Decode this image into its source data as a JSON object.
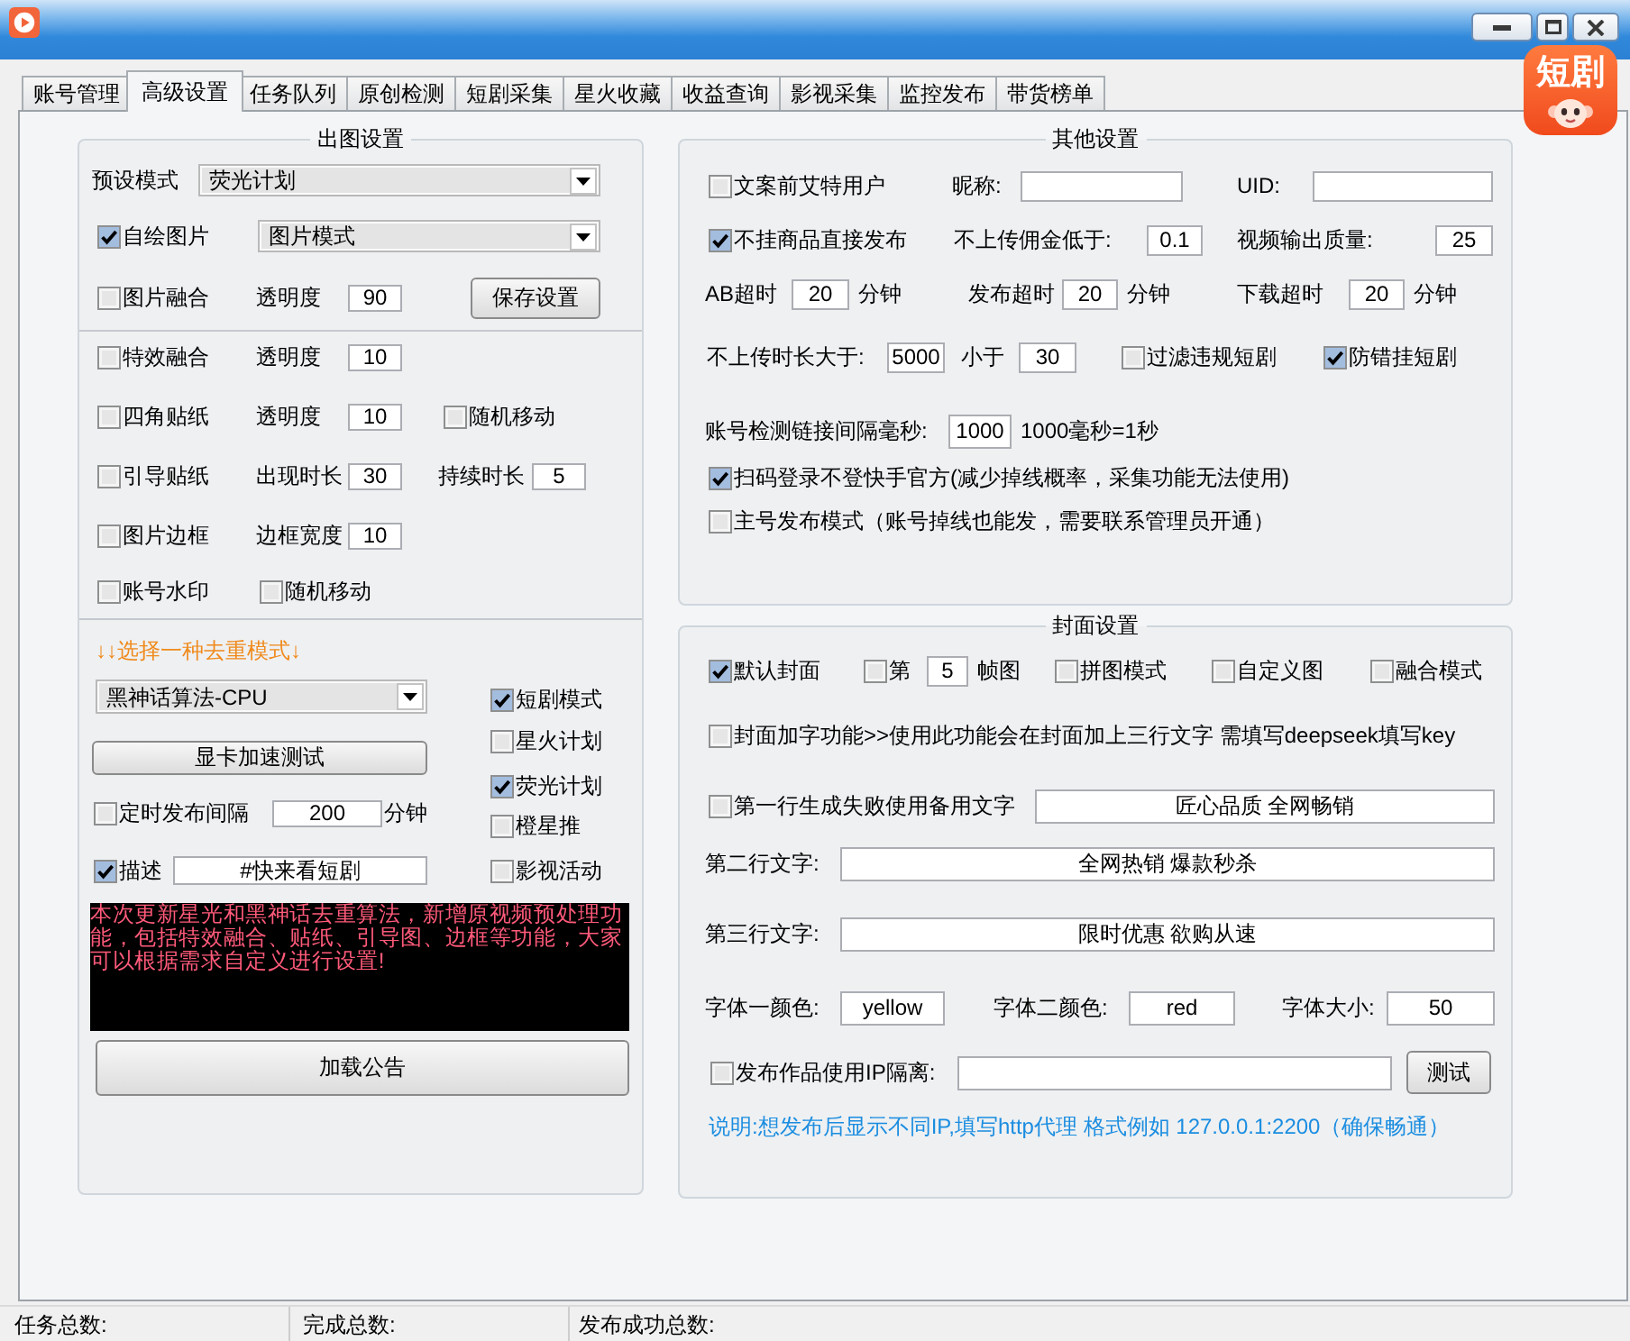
{
  "tabs": [
    {
      "label": "账号管理",
      "selected": false
    },
    {
      "label": "高级设置",
      "selected": true
    },
    {
      "label": "任务队列",
      "selected": false
    },
    {
      "label": "原创检测",
      "selected": false
    },
    {
      "label": "短剧采集",
      "selected": false
    },
    {
      "label": "星火收藏",
      "selected": false
    },
    {
      "label": "收益查询",
      "selected": false
    },
    {
      "label": "影视采集",
      "selected": false
    },
    {
      "label": "监控发布",
      "selected": false
    },
    {
      "label": "带货榜单",
      "selected": false
    }
  ],
  "logo": {
    "text": "短剧"
  },
  "output_settings": {
    "title": "出图设置",
    "rows": [
      {
        "controls": [
          {
            "kind": "label",
            "text": "预设模式"
          },
          {
            "kind": "select",
            "value": "荧光计划"
          }
        ]
      },
      {
        "controls": [
          {
            "kind": "checkbox",
            "label": "自绘图片",
            "checked": true
          },
          {
            "kind": "select",
            "value": "图片模式"
          }
        ]
      },
      {
        "controls": [
          {
            "kind": "checkbox",
            "label": "图片融合",
            "checked": false
          },
          {
            "kind": "label",
            "text": "透明度"
          },
          {
            "kind": "input",
            "value": "90"
          },
          {
            "kind": "button",
            "label": "保存设置"
          }
        ]
      }
    ],
    "effect_rows": [
      {
        "controls": [
          {
            "kind": "checkbox",
            "label": "特效融合",
            "checked": false
          },
          {
            "kind": "label",
            "text": "透明度"
          },
          {
            "kind": "input",
            "value": "10"
          }
        ]
      },
      {
        "controls": [
          {
            "kind": "checkbox",
            "label": "四角贴纸",
            "checked": false
          },
          {
            "kind": "label",
            "text": "透明度"
          },
          {
            "kind": "input",
            "value": "10"
          },
          {
            "kind": "checkbox",
            "label": "随机移动",
            "checked": false
          }
        ]
      },
      {
        "controls": [
          {
            "kind": "checkbox",
            "label": "引导贴纸",
            "checked": false
          },
          {
            "kind": "label",
            "text": "出现时长"
          },
          {
            "kind": "input",
            "value": "30"
          },
          {
            "kind": "label",
            "text": "持续时长"
          },
          {
            "kind": "input",
            "value": "5"
          }
        ]
      },
      {
        "controls": [
          {
            "kind": "checkbox",
            "label": "图片边框",
            "checked": false
          },
          {
            "kind": "label",
            "text": "边框宽度"
          },
          {
            "kind": "input",
            "value": "10"
          }
        ]
      },
      {
        "controls": [
          {
            "kind": "checkbox",
            "label": "账号水印",
            "checked": false
          },
          {
            "kind": "checkbox",
            "label": "随机移动",
            "checked": false
          }
        ]
      }
    ]
  },
  "dedup": {
    "heading": "↓↓选择一种去重模式↓",
    "algorithm": "黑神话算法-CPU",
    "gpu_test_button": "显卡加速测试",
    "schedule": {
      "label": "定时发布间隔",
      "checked": false,
      "value": "200",
      "unit": "分钟"
    },
    "description": {
      "label": "描述",
      "checked": true,
      "value": "#快来看短剧"
    },
    "modes": [
      {
        "label": "短剧模式",
        "checked": true
      },
      {
        "label": "星火计划",
        "checked": false
      },
      {
        "label": "荧光计划",
        "checked": true
      },
      {
        "label": "橙星推",
        "checked": false
      },
      {
        "label": "影视活动",
        "checked": false
      }
    ]
  },
  "announcement": {
    "text": "本次更新星光和黑神话去重算法，新增原视频预处理功能，包括特效融合、贴纸、引导图、边框等功能，大家可以根据需求自定义进行设置!",
    "button": "加载公告"
  },
  "other_settings": {
    "title": "其他设置",
    "rows": [
      {
        "controls": [
          {
            "kind": "checkbox",
            "label": "文案前艾特用户",
            "checked": false
          },
          {
            "kind": "label",
            "text": "昵称:"
          },
          {
            "kind": "input"
          },
          {
            "kind": "label",
            "text": "UID:"
          },
          {
            "kind": "input"
          }
        ]
      },
      {
        "controls": [
          {
            "kind": "checkbox",
            "label": "不挂商品直接发布",
            "checked": true
          },
          {
            "kind": "label",
            "text": "不上传佣金低于:"
          },
          {
            "kind": "input",
            "value": "0.1"
          },
          {
            "kind": "label",
            "text": "视频输出质量:"
          },
          {
            "kind": "input",
            "value": "25"
          }
        ]
      },
      {
        "controls": [
          {
            "kind": "label",
            "text": "AB超时"
          },
          {
            "kind": "input",
            "value": "20"
          },
          {
            "kind": "label",
            "text": "分钟"
          },
          {
            "kind": "label",
            "text": "发布超时"
          },
          {
            "kind": "input",
            "value": "20"
          },
          {
            "kind": "label",
            "text": "分钟"
          },
          {
            "kind": "label",
            "text": "下载超时"
          },
          {
            "kind": "input",
            "value": "20"
          },
          {
            "kind": "label",
            "text": "分钟"
          }
        ]
      },
      {
        "controls": [
          {
            "kind": "label",
            "text": "不上传时长大于:"
          },
          {
            "kind": "input",
            "value": "5000"
          },
          {
            "kind": "label",
            "text": "小于"
          },
          {
            "kind": "input",
            "value": "30"
          },
          {
            "kind": "checkbox",
            "label": "过滤违规短剧",
            "checked": false
          },
          {
            "kind": "checkbox",
            "label": "防错挂短剧",
            "checked": true
          }
        ]
      },
      {
        "controls": [
          {
            "kind": "label",
            "text": "账号检测链接间隔毫秒:"
          },
          {
            "kind": "input",
            "value": "1000"
          },
          {
            "kind": "label",
            "text": "1000毫秒=1秒"
          }
        ]
      },
      {
        "controls": [
          {
            "kind": "checkbox",
            "label": "扫码登录不登快手官方(减少掉线概率，采集功能无法使用)",
            "checked": true
          }
        ]
      },
      {
        "controls": [
          {
            "kind": "checkbox",
            "label": "主号发布模式（账号掉线也能发，需要联系管理员开通）",
            "checked": false
          }
        ]
      }
    ]
  },
  "cover_settings": {
    "title": "封面设置",
    "rows": [
      {
        "controls": [
          {
            "kind": "checkbox",
            "label": "默认封面",
            "checked": true
          },
          {
            "kind": "checkbox",
            "label": "第",
            "checked": false
          },
          {
            "kind": "input",
            "value": "5"
          },
          {
            "kind": "label",
            "text": "帧图"
          },
          {
            "kind": "checkbox",
            "label": "拼图模式",
            "checked": false
          },
          {
            "kind": "checkbox",
            "label": "自定义图",
            "checked": false
          },
          {
            "kind": "checkbox",
            "label": "融合模式",
            "checked": false
          }
        ]
      },
      {
        "controls": [
          {
            "kind": "checkbox",
            "label": "封面加字功能>>使用此功能会在封面加上三行文字 需填写deepseek填写key",
            "checked": false
          }
        ]
      },
      {
        "controls": [
          {
            "kind": "checkbox",
            "label": "第一行生成失败使用备用文字",
            "checked": false
          },
          {
            "kind": "input",
            "value": "匠心品质 全网畅销"
          }
        ]
      },
      {
        "controls": [
          {
            "kind": "label",
            "text": "第二行文字:"
          },
          {
            "kind": "input",
            "value": "全网热销 爆款秒杀"
          }
        ]
      },
      {
        "controls": [
          {
            "kind": "label",
            "text": "第三行文字:"
          },
          {
            "kind": "input",
            "value": "限时优惠 欲购从速"
          }
        ]
      },
      {
        "controls": [
          {
            "kind": "label",
            "text": "字体一颜色:"
          },
          {
            "kind": "input",
            "value": "yellow"
          },
          {
            "kind": "label",
            "text": "字体二颜色:"
          },
          {
            "kind": "input",
            "value": "red"
          },
          {
            "kind": "label",
            "text": "字体大小:"
          },
          {
            "kind": "input",
            "value": "50"
          }
        ]
      },
      {
        "controls": [
          {
            "kind": "checkbox",
            "label": "发布作品使用IP隔离:",
            "checked": false
          },
          {
            "kind": "input"
          },
          {
            "kind": "button",
            "label": "测试"
          }
        ]
      }
    ],
    "note": "说明:想发布后显示不同IP,填写http代理 格式例如 127.0.0.1:2200（确保畅通）"
  },
  "status_bar": [
    "任务总数:",
    "完成总数:",
    "发布成功总数:"
  ]
}
